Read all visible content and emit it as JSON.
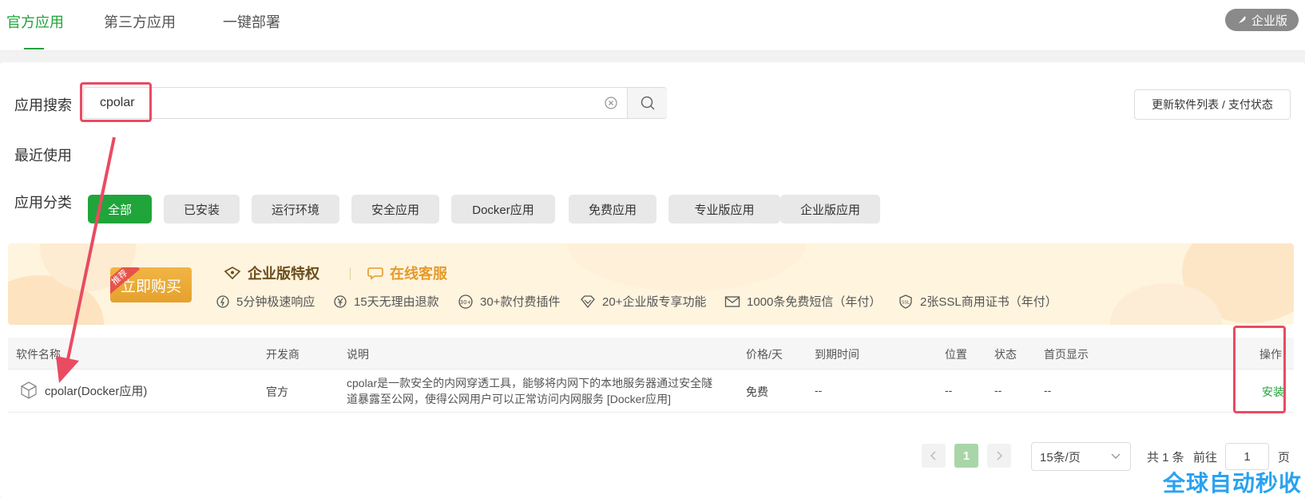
{
  "tabs": [
    {
      "label": "官方应用",
      "active": true
    },
    {
      "label": "第三方应用",
      "active": false
    },
    {
      "label": "一键部署",
      "active": false
    }
  ],
  "enterprise_badge": "企业版",
  "search": {
    "label": "应用搜索",
    "value": "cpolar"
  },
  "refresh_button": "更新软件列表 / 支付状态",
  "recent_label": "最近使用",
  "category_label": "应用分类",
  "categories": [
    "全部",
    "已安装",
    "运行环境",
    "安全应用",
    "Docker应用",
    "免费应用",
    "专业版应用",
    "企业版应用"
  ],
  "active_category": "全部",
  "banner": {
    "tag": "推荐",
    "buy_button": "立即购买",
    "title": "企业版特权",
    "service": "在线客服",
    "features": [
      "5分钟极速响应",
      "15天无理由退款",
      "30+款付费插件",
      "20+企业版专享功能",
      "1000条免费短信（年付）",
      "2张SSL商用证书（年付）"
    ]
  },
  "table": {
    "headers": [
      "软件名称",
      "开发商",
      "说明",
      "价格/天",
      "到期时间",
      "位置",
      "状态",
      "首页显示",
      "操作"
    ],
    "rows": [
      {
        "name": "cpolar(Docker应用)",
        "developer": "官方",
        "description": "cpolar是一款安全的内网穿透工具，能够将内网下的本地服务器通过安全隧道暴露至公网，使得公网用户可以正常访问内网服务 [Docker应用]",
        "price": "免费",
        "expiry": "--",
        "location": "--",
        "status": "--",
        "homepage": "--",
        "action": "安装"
      }
    ]
  },
  "pagination": {
    "current": "1",
    "page_size": "15条/页",
    "total_label": "共 1 条",
    "goto_label": "前往",
    "goto_value": "1",
    "page_unit": "页"
  },
  "watermark": "全球自动秒收",
  "colors": {
    "accent": "#20a53a",
    "highlight": "#e94b62",
    "banner_bg": "#fff4de",
    "watermark": "#2aa2f0"
  }
}
